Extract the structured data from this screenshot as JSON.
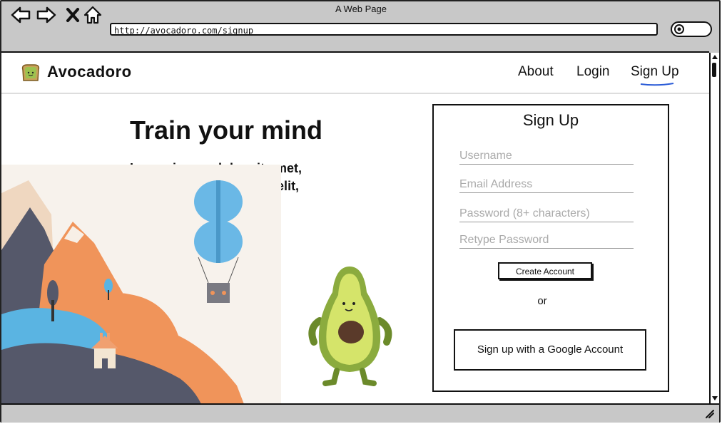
{
  "browser": {
    "window_title": "A Web Page",
    "url": "http://avocadoro.com/signup"
  },
  "site": {
    "brand": "Avocadoro",
    "nav": {
      "about": "About",
      "login": "Login",
      "signup": "Sign Up"
    }
  },
  "hero": {
    "headline": "Train your mind",
    "lead": "Lorem ipsum dolor sit amet, consectetur adipisicing elit,"
  },
  "signup_form": {
    "title": "Sign Up",
    "username_placeholder": "Username",
    "email_placeholder": "Email Address",
    "password_placeholder": "Password (8+ characters)",
    "retype_placeholder": "Retype Password",
    "create_label": "Create Account",
    "or_label": "or",
    "google_label": "Sign up with a Google Account"
  },
  "icons": [
    "back-icon",
    "forward-icon",
    "close-icon",
    "home-icon",
    "search-icon",
    "toast-logo-icon",
    "resize-grip-icon"
  ],
  "colors": {
    "frame": "#c8c8c8",
    "accent_underline": "#2a5bd7",
    "mountain_dark": "#55586a",
    "mountain_orange": "#f0945a",
    "lake_blue": "#5ab4e2",
    "avocado_green": "#8bab3e",
    "pit_brown": "#5a3a2a"
  }
}
